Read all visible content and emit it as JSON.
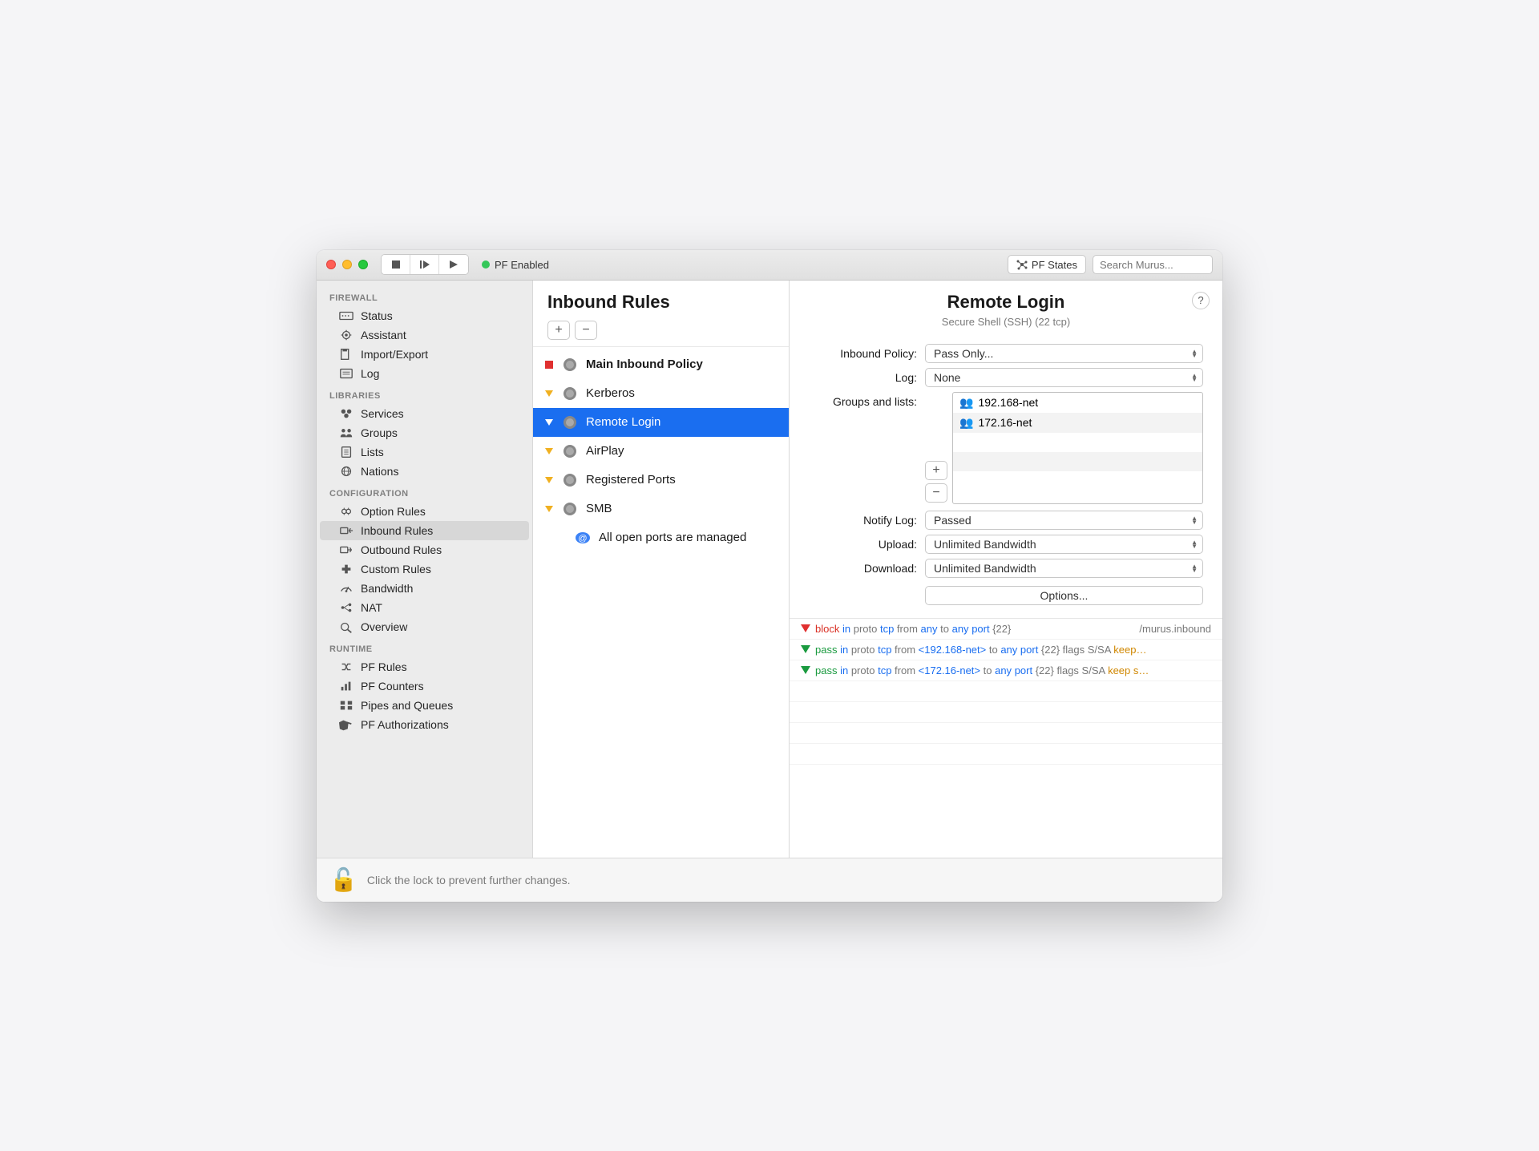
{
  "titlebar": {
    "status_label": "PF Enabled",
    "pf_states_label": "PF States",
    "search_placeholder": "Search Murus..."
  },
  "sidebar": {
    "sections": [
      {
        "header": "FIREWALL",
        "items": [
          {
            "icon": "status",
            "label": "Status"
          },
          {
            "icon": "assistant",
            "label": "Assistant"
          },
          {
            "icon": "importexport",
            "label": "Import/Export"
          },
          {
            "icon": "log",
            "label": "Log"
          }
        ]
      },
      {
        "header": "LIBRARIES",
        "items": [
          {
            "icon": "services",
            "label": "Services"
          },
          {
            "icon": "groups",
            "label": "Groups"
          },
          {
            "icon": "lists",
            "label": "Lists"
          },
          {
            "icon": "nations",
            "label": "Nations"
          }
        ]
      },
      {
        "header": "CONFIGURATION",
        "items": [
          {
            "icon": "option",
            "label": "Option Rules"
          },
          {
            "icon": "inbound",
            "label": "Inbound Rules",
            "selected": true
          },
          {
            "icon": "outbound",
            "label": "Outbound Rules"
          },
          {
            "icon": "custom",
            "label": "Custom Rules"
          },
          {
            "icon": "bandwidth",
            "label": "Bandwidth"
          },
          {
            "icon": "nat",
            "label": "NAT"
          },
          {
            "icon": "overview",
            "label": "Overview"
          }
        ]
      },
      {
        "header": "RUNTIME",
        "items": [
          {
            "icon": "pfrules",
            "label": "PF Rules"
          },
          {
            "icon": "pfcounters",
            "label": "PF Counters"
          },
          {
            "icon": "pipes",
            "label": "Pipes and Queues"
          },
          {
            "icon": "pfauth",
            "label": "PF Authorizations"
          }
        ]
      }
    ]
  },
  "mid": {
    "title": "Inbound Rules",
    "rules": [
      {
        "marker": "red-square",
        "bold": true,
        "label": "Main Inbound Policy"
      },
      {
        "marker": "tri",
        "label": "Kerberos"
      },
      {
        "marker": "tri",
        "label": "Remote Login",
        "selected": true
      },
      {
        "marker": "tri",
        "label": "AirPlay"
      },
      {
        "marker": "tri",
        "label": "Registered Ports"
      },
      {
        "marker": "tri",
        "label": "SMB"
      },
      {
        "marker": "info",
        "label": "All open ports are managed",
        "indent": true
      }
    ]
  },
  "detail": {
    "title": "Remote Login",
    "subtitle": "Secure Shell (SSH) (22 tcp)",
    "labels": {
      "inbound_policy": "Inbound Policy:",
      "log": "Log:",
      "groups": "Groups and lists:",
      "notify": "Notify Log:",
      "upload": "Upload:",
      "download": "Download:"
    },
    "values": {
      "inbound_policy": "Pass Only...",
      "log": "None",
      "notify": "Passed",
      "upload": "Unlimited Bandwidth",
      "download": "Unlimited Bandwidth",
      "options_btn": "Options..."
    },
    "groups": [
      "192.168-net",
      "172.16-net"
    ],
    "pf_lines": [
      {
        "dir": "down-red",
        "html": "<span class='red'>block</span> <span class='blue'>in</span> proto <span class='blue'>tcp</span> from <span class='blue'>any</span> to <span class='blue'>any</span> <span class='blue'>port</span> {22}",
        "right": "/murus.inbound"
      },
      {
        "dir": "down-green",
        "html": "<span class='green'>pass</span> <span class='blue'>in</span> proto <span class='blue'>tcp</span> from <span class='blue'>&lt;192.168-net&gt;</span> to <span class='blue'>any</span> <span class='blue'>port</span> {22} flags S/SA <span class='orange'>keep…</span>"
      },
      {
        "dir": "down-green",
        "html": "<span class='green'>pass</span> <span class='blue'>in</span> proto <span class='blue'>tcp</span> from <span class='blue'>&lt;172.16-net&gt;</span> to <span class='blue'>any</span> <span class='blue'>port</span> {22} flags S/SA <span class='orange'>keep s…</span>"
      }
    ]
  },
  "footer": {
    "text": "Click the lock to prevent further changes."
  }
}
